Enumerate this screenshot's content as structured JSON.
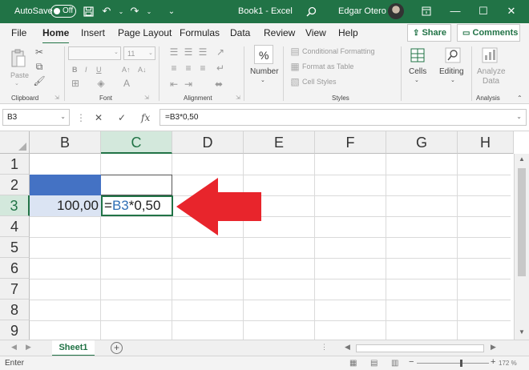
{
  "titlebar": {
    "autosave_label": "AutoSave",
    "autosave_state": "Off",
    "doc_title": "Book1 - Excel",
    "user_name": "Edgar Otero",
    "icons": [
      "save-icon",
      "undo-icon",
      "redo-icon",
      "customize-icon",
      "search-icon",
      "minimize-icon",
      "restore-icon",
      "close-icon"
    ]
  },
  "menu": {
    "items": [
      "File",
      "Home",
      "Insert",
      "Page Layout",
      "Formulas",
      "Data",
      "Review",
      "View",
      "Help"
    ],
    "active": "Home",
    "share_label": "Share",
    "comments_label": "Comments"
  },
  "ribbon": {
    "clipboard": {
      "paste_label": "Paste",
      "group_label": "Clipboard"
    },
    "font": {
      "font_size": "11",
      "group_label": "Font"
    },
    "alignment": {
      "group_label": "Alignment"
    },
    "number": {
      "button_label": "Number",
      "symbol": "%"
    },
    "styles": {
      "conditional_formatting": "Conditional Formatting",
      "format_as_table": "Format as Table",
      "cell_styles": "Cell Styles",
      "group_label": "Styles"
    },
    "cells": {
      "button_label": "Cells"
    },
    "editing": {
      "button_label": "Editing"
    },
    "analysis": {
      "button_label_1": "Analyze",
      "button_label_2": "Data",
      "group_label": "Analysis"
    }
  },
  "formula_bar": {
    "name_box": "B3",
    "cancel_symbol": "✕",
    "enter_symbol": "✓",
    "fx_symbol": "fx",
    "formula": "=B3*0,50"
  },
  "grid": {
    "columns": [
      "B",
      "C",
      "D",
      "E",
      "F",
      "G",
      "H"
    ],
    "selected_column": "C",
    "rows": [
      "1",
      "2",
      "3",
      "4",
      "5",
      "6",
      "7",
      "8",
      "9"
    ],
    "selected_row": "3",
    "cells": {
      "B3": "100,00",
      "C3_prefix": "=",
      "C3_ref": "B3",
      "C3_suffix": "*0,50"
    },
    "colors": {
      "b2_fill": "#4472c4",
      "b3_fill": "#dbe4f3",
      "arrow": "#e8252c",
      "ref_text": "#2f6fb5"
    }
  },
  "sheets": {
    "tabs": [
      "Sheet1"
    ],
    "active": "Sheet1"
  },
  "status": {
    "mode": "Enter",
    "zoom": "172 %"
  },
  "accent_color": "#217346"
}
